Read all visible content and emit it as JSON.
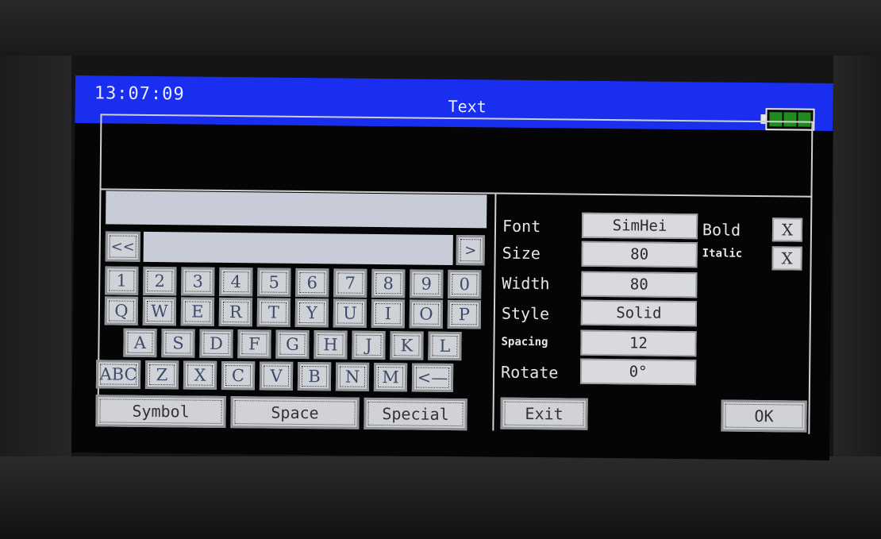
{
  "titlebar": {
    "clock": "13:07:09",
    "title": "Text",
    "battery_icon": "battery-full-icon"
  },
  "keyboard": {
    "prev": "<<",
    "next": ">",
    "row1": [
      "1",
      "2",
      "3",
      "4",
      "5",
      "6",
      "7",
      "8",
      "9",
      "0"
    ],
    "row2": [
      "Q",
      "W",
      "E",
      "R",
      "T",
      "Y",
      "U",
      "I",
      "O",
      "P"
    ],
    "row3": [
      "A",
      "S",
      "D",
      "F",
      "G",
      "H",
      "J",
      "K",
      "L"
    ],
    "row4": [
      "ABC",
      "Z",
      "X",
      "C",
      "V",
      "B",
      "N",
      "M",
      "<—"
    ],
    "bottom": [
      "Symbol",
      "Space",
      "Special"
    ]
  },
  "settings": {
    "font_label": "Font",
    "font_value": "SimHei",
    "size_label": "Size",
    "size_value": "80",
    "width_label": "Width",
    "width_value": "80",
    "style_label": "Style",
    "style_value": "Solid",
    "spacing_label": "Spacing",
    "spacing_value": "12",
    "rotate_label": "Rotate",
    "rotate_value": "0°",
    "bold_label": "Bold",
    "bold_value": "X",
    "italic_label": "Italic",
    "italic_value": "X"
  },
  "actions": {
    "exit": "Exit",
    "ok": "OK"
  }
}
